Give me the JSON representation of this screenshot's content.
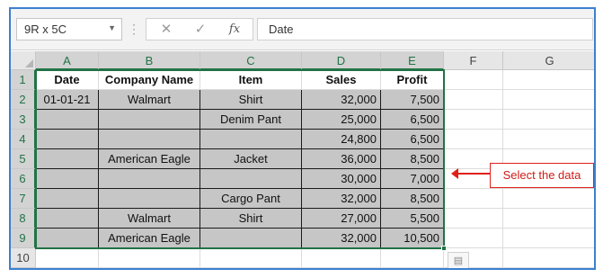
{
  "formula_bar": {
    "name_box": "9R x 5C",
    "cancel_glyph": "✕",
    "enter_glyph": "✓",
    "fx_label": "fx",
    "formula_value": "Date"
  },
  "columns": [
    "A",
    "B",
    "C",
    "D",
    "E",
    "F",
    "G"
  ],
  "rows": [
    "1",
    "2",
    "3",
    "4",
    "5",
    "6",
    "7",
    "8",
    "9",
    "10"
  ],
  "sheet": {
    "header": [
      "Date",
      "Company Name",
      "Item",
      "Sales",
      "Profit"
    ],
    "data": [
      [
        "01-01-21",
        "Walmart",
        "Shirt",
        "32,000",
        "7,500"
      ],
      [
        "",
        "",
        "Denim Pant",
        "25,000",
        "6,500"
      ],
      [
        "",
        "",
        "",
        "24,800",
        "6,500"
      ],
      [
        "",
        "American Eagle",
        "Jacket",
        "36,000",
        "8,500"
      ],
      [
        "",
        "",
        "",
        "30,000",
        "7,000"
      ],
      [
        "",
        "",
        "Cargo Pant",
        "32,000",
        "8,500"
      ],
      [
        "",
        "Walmart",
        "Shirt",
        "27,000",
        "5,500"
      ],
      [
        "",
        "American Eagle",
        "",
        "32,000",
        "10,500"
      ]
    ]
  },
  "annotation": {
    "label": "Select the data",
    "color": "#e0201b"
  },
  "colors": {
    "selection": "#217346",
    "fill": "#c6c6c6",
    "frame": "#3d7fd1"
  }
}
